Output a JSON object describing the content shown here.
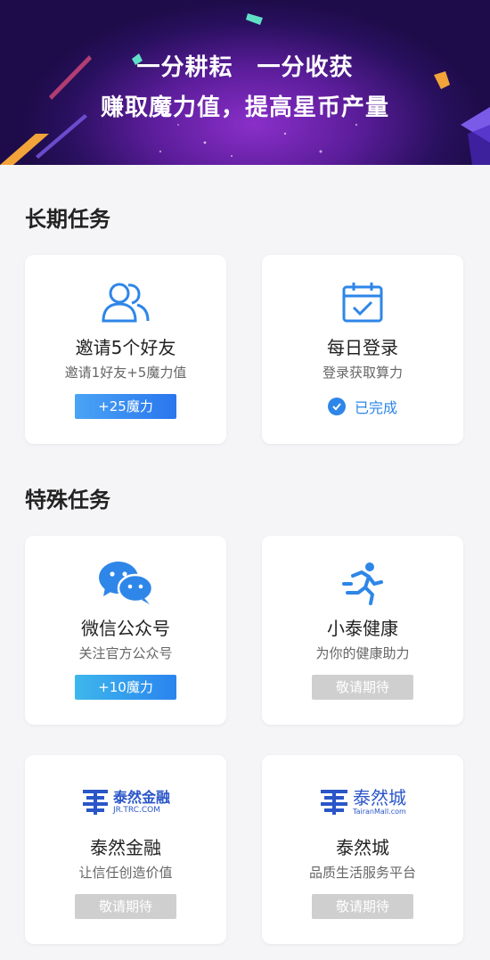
{
  "banner": {
    "line1": "一分耕耘　一分收获",
    "line2": "赚取魔力值，提高星币产量"
  },
  "long_term": {
    "title": "长期任务",
    "cards": [
      {
        "icon": "users-icon",
        "title": "邀请5个好友",
        "subtitle": "邀请1好友+5魔力值",
        "badge": "+25魔力"
      },
      {
        "icon": "calendar-check-icon",
        "title": "每日登录",
        "subtitle": "登录获取算力",
        "status": "已完成"
      }
    ]
  },
  "special": {
    "title": "特殊任务",
    "cards": [
      {
        "icon": "wechat-icon",
        "title": "微信公众号",
        "subtitle": "关注官方公众号",
        "badge": "+10魔力"
      },
      {
        "icon": "runner-icon",
        "title": "小泰健康",
        "subtitle": "为你的健康助力",
        "badge": "敬请期待"
      },
      {
        "icon": "tairan-finance-logo",
        "logo_text": "泰然金融",
        "logo_sub": "JR.TRC.COM",
        "title": "泰然金融",
        "subtitle": "让信任创造价值",
        "badge": "敬请期待"
      },
      {
        "icon": "tairan-mall-logo",
        "logo_text": "泰然城",
        "logo_sub": "TairanMall.com",
        "title": "泰然城",
        "subtitle": "品质生活服务平台",
        "badge": "敬请期待"
      }
    ]
  },
  "colors": {
    "accent": "#2e86e8",
    "banner_dark": "#1d0c49",
    "banner_mid": "#8a2fc9",
    "disabled": "#cfcfcf"
  }
}
